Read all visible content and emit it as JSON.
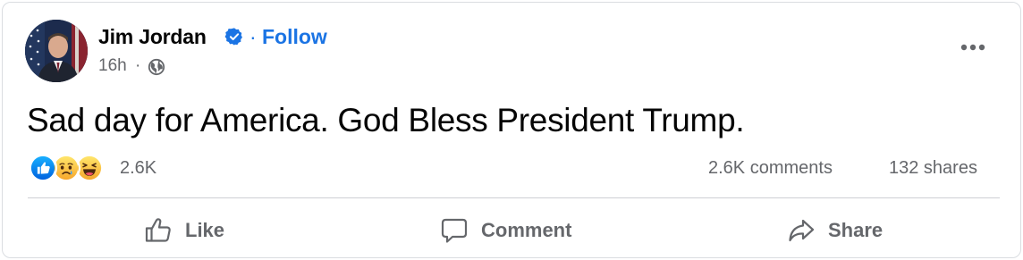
{
  "post": {
    "author": "Jim Jordan",
    "follow_label": "Follow",
    "separator": "·",
    "timestamp": "16h",
    "meta_separator": "·",
    "audience_icon": "globe-icon",
    "text": "Sad day for America. God Bless President Trump."
  },
  "stats": {
    "reaction_icons": [
      "like-reaction-icon",
      "sad-reaction-icon",
      "haha-reaction-icon"
    ],
    "reaction_count": "2.6K",
    "comments": "2.6K comments",
    "shares": "132 shares"
  },
  "actions": {
    "like": "Like",
    "comment": "Comment",
    "share": "Share"
  },
  "colors": {
    "accent": "#1b74e4",
    "secondary_text": "#65676b",
    "primary_text": "#050505",
    "divider": "#ced0d4"
  }
}
